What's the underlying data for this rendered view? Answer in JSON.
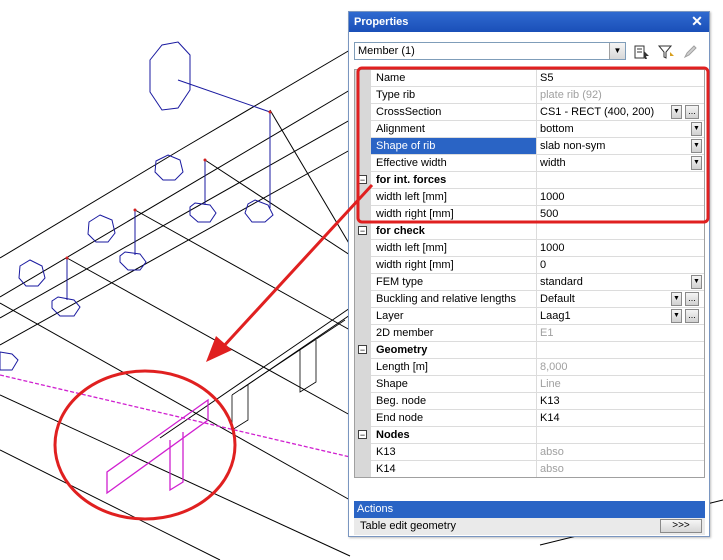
{
  "panel": {
    "title": "Properties",
    "member_select": "Member (1)"
  },
  "icons": {
    "close": "close-icon",
    "select": "select-elements-icon",
    "filter": "filter-icon",
    "edit": "edit-pencil-icon"
  },
  "rows": [
    {
      "type": "prop",
      "label": "Name",
      "value": "S5"
    },
    {
      "type": "prop",
      "label": "Type rib",
      "value": "plate rib (92)",
      "disabled": true
    },
    {
      "type": "prop",
      "label": "CrossSection",
      "value": "CS1 - RECT (400, 200)",
      "dropdown": true,
      "dots": true
    },
    {
      "type": "prop",
      "label": "Alignment",
      "value": "bottom",
      "dropdown": true
    },
    {
      "type": "prop",
      "label": "Shape of rib",
      "value": "slab non-sym",
      "dropdown": true,
      "selected": true
    },
    {
      "type": "prop",
      "label": "Effective width",
      "value": "width",
      "dropdown": true
    },
    {
      "type": "group",
      "label": "for int. forces"
    },
    {
      "type": "prop",
      "label": "width left  [mm]",
      "value": "1000"
    },
    {
      "type": "prop",
      "label": "width right [mm]",
      "value": "500"
    },
    {
      "type": "group",
      "label": "for check"
    },
    {
      "type": "prop",
      "label": "width left  [mm]",
      "value": "1000"
    },
    {
      "type": "prop",
      "label": "width right [mm]",
      "value": "0"
    },
    {
      "type": "prop",
      "label": "FEM type",
      "value": "standard",
      "dropdown": true
    },
    {
      "type": "prop",
      "label": "Buckling and relative lengths",
      "value": "Default",
      "dropdown": true,
      "dots": true
    },
    {
      "type": "prop",
      "label": "Layer",
      "value": "Laag1",
      "dropdown": true,
      "dots": true
    },
    {
      "type": "prop",
      "label": "2D member",
      "value": "E1",
      "disabled": true
    },
    {
      "type": "group",
      "label": "Geometry"
    },
    {
      "type": "prop",
      "label": "Length [m]",
      "value": "8,000",
      "disabled": true
    },
    {
      "type": "prop",
      "label": "Shape",
      "value": "Line",
      "disabled": true
    },
    {
      "type": "prop",
      "label": "Beg. node",
      "value": "K13"
    },
    {
      "type": "prop",
      "label": "End node",
      "value": "K14"
    },
    {
      "type": "group",
      "label": "Nodes"
    },
    {
      "type": "prop",
      "label": "K13",
      "value": "abso",
      "disabled": true
    },
    {
      "type": "prop",
      "label": "K14",
      "value": "abso",
      "disabled": true
    }
  ],
  "actions": {
    "header": "Actions",
    "item_label": "Table edit geometry",
    "item_button": ">>>"
  },
  "colors": {
    "model_lines": "#000000",
    "supports": "#1a1aa0",
    "rib_magenta": "#d020d0",
    "annotation_red": "#e02020",
    "selection_blue": "#2a64c5"
  }
}
